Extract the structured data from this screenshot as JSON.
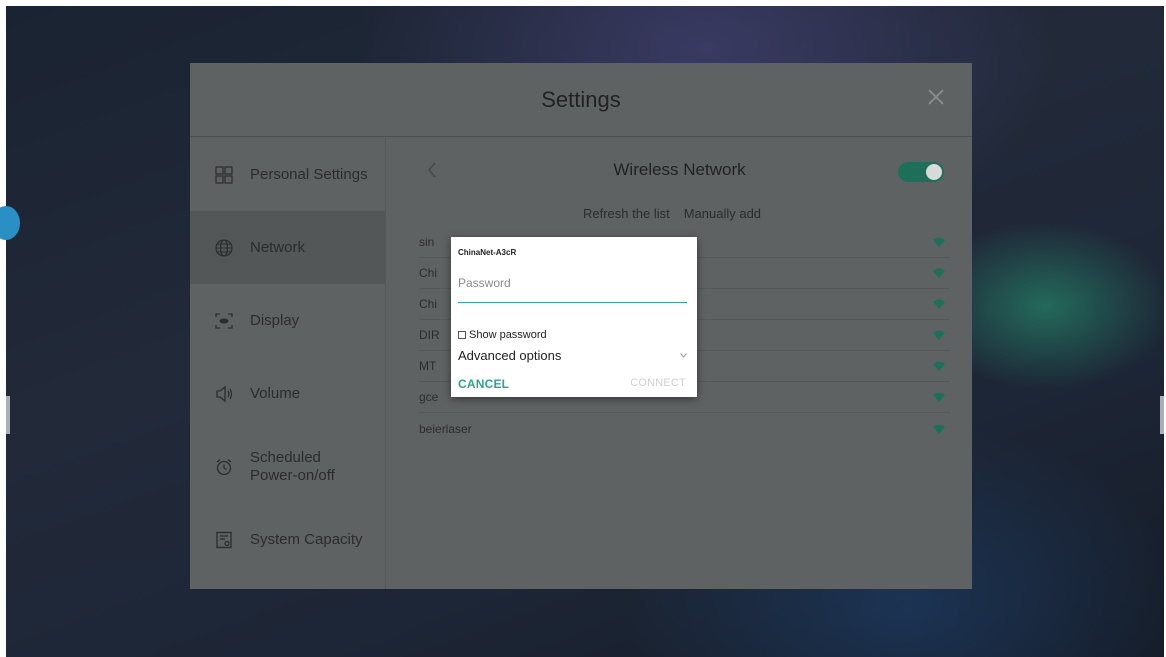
{
  "window": {
    "title": "Settings"
  },
  "sidebar": {
    "items": [
      {
        "label": "Personal Settings",
        "icon": "grid-icon"
      },
      {
        "label": "Network",
        "icon": "globe-icon"
      },
      {
        "label": "Display",
        "icon": "display-icon"
      },
      {
        "label": "Volume",
        "icon": "speaker-icon"
      },
      {
        "label": "Scheduled Power-on/off",
        "icon": "clock-icon"
      },
      {
        "label": "System Capacity",
        "icon": "storage-icon"
      }
    ],
    "active": "Network"
  },
  "wireless": {
    "title": "Wireless Network",
    "enabled": true,
    "refresh_label": "Refresh the list",
    "manual_label": "Manually add",
    "networks": [
      {
        "name": "sin"
      },
      {
        "name": "Chi"
      },
      {
        "name": "Chi"
      },
      {
        "name": "DIR"
      },
      {
        "name": "MT"
      },
      {
        "name": "gce"
      },
      {
        "name": "beierlaser"
      }
    ]
  },
  "dialog": {
    "ssid": "ChinaNet-A3cR",
    "password_placeholder": "Password",
    "show_password_label": "Show password",
    "advanced_label": "Advanced options",
    "cancel_label": "CANCEL",
    "connect_label": "CONNECT"
  },
  "colors": {
    "accent": "#2ca58d",
    "toggle_on": "#1e6f5a",
    "dialog_underline": "#3aa890"
  }
}
